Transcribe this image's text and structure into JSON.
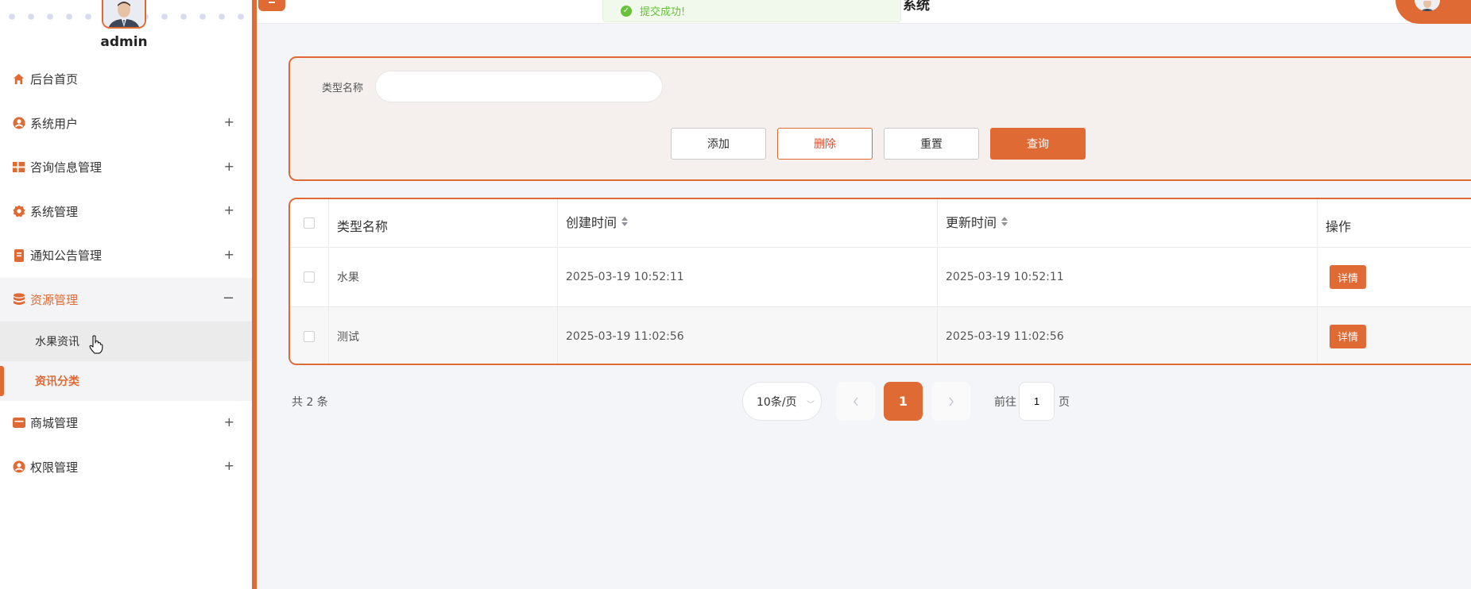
{
  "sidebar": {
    "username": "admin",
    "menu": [
      {
        "label": "后台首页",
        "icon": "home-icon"
      },
      {
        "label": "系统用户",
        "icon": "user-circle-icon"
      },
      {
        "label": "咨询信息管理",
        "icon": "grid-icon"
      },
      {
        "label": "系统管理",
        "icon": "gear-icon"
      },
      {
        "label": "通知公告管理",
        "icon": "document-icon"
      },
      {
        "label": "资源管理",
        "icon": "database-icon"
      },
      {
        "label": "商城管理",
        "icon": "shop-icon"
      },
      {
        "label": "权限管理",
        "icon": "user-circle-icon"
      }
    ],
    "submenu": [
      {
        "label": "水果资讯"
      },
      {
        "label": "资讯分类"
      }
    ],
    "expand_symbol": "+",
    "collapse_symbol": "−"
  },
  "header": {
    "toast": "提交成功!",
    "title": "系统"
  },
  "search": {
    "label": "类型名称",
    "value": "",
    "placeholder": ""
  },
  "buttons": {
    "add": "添加",
    "delete": "删除",
    "reset": "重置",
    "query": "查询"
  },
  "table": {
    "headers": [
      "类型名称",
      "创建时间",
      "更新时间",
      "操作"
    ],
    "rows": [
      {
        "name": "水果",
        "created": "2025-03-19 10:52:11",
        "updated": "2025-03-19 10:52:11",
        "action": "详情"
      },
      {
        "name": "测试",
        "created": "2025-03-19 11:02:56",
        "updated": "2025-03-19 11:02:56",
        "action": "详情"
      }
    ]
  },
  "pagination": {
    "total": "共 2 条",
    "page_size": "10条/页",
    "current_page": "1",
    "goto_label": "前往",
    "goto_value": "1",
    "goto_suffix": "页"
  },
  "colors": {
    "accent": "#e06a34",
    "success": "#67c23a"
  }
}
